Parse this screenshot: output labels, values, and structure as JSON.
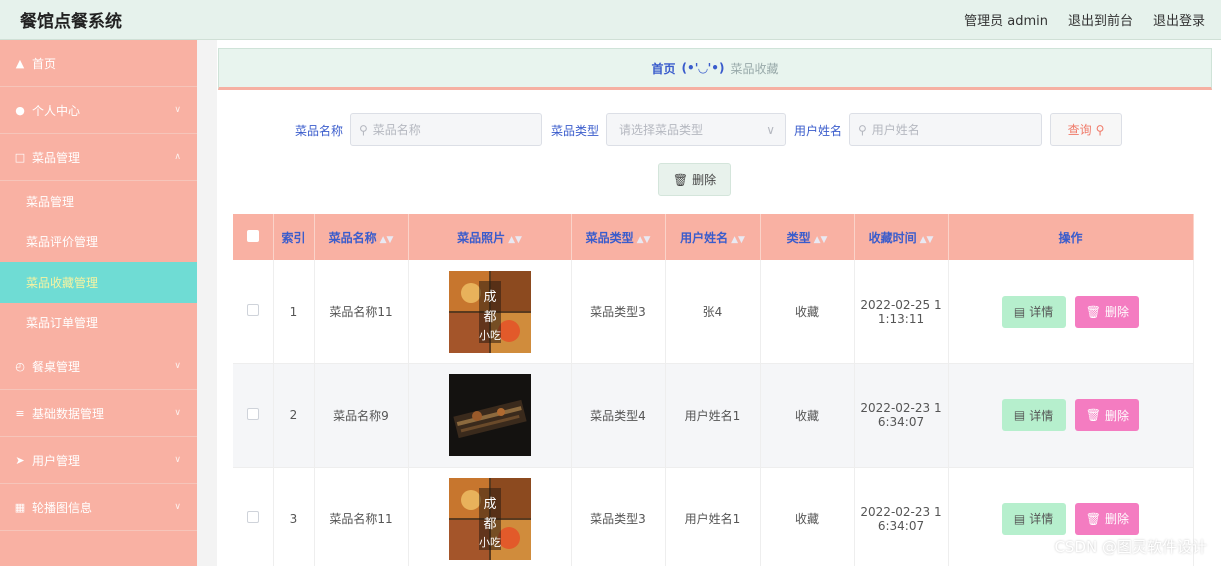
{
  "header": {
    "app_title": "餐馆点餐系统",
    "admin_label": "管理员 admin",
    "front_link": "退出到前台",
    "logout_link": "退出登录"
  },
  "sidebar": {
    "items": [
      {
        "icon": "home-icon",
        "label": "首页"
      },
      {
        "icon": "user-icon",
        "label": "个人中心"
      },
      {
        "icon": "expand-icon",
        "label": "菜品管理"
      }
    ],
    "sub_items": [
      "菜品管理",
      "菜品评价管理",
      "菜品收藏管理",
      "菜品订单管理"
    ],
    "items_after": [
      {
        "icon": "clock-icon",
        "label": "餐桌管理"
      },
      {
        "icon": "list-icon",
        "label": "基础数据管理"
      },
      {
        "icon": "plane-icon",
        "label": "用户管理"
      },
      {
        "icon": "grid-icon",
        "label": "轮播图信息"
      }
    ]
  },
  "breadcrumb": {
    "home": "首页",
    "face": "(•'◡'•)",
    "current": "菜品收藏"
  },
  "search": {
    "name_label": "菜品名称",
    "name_placeholder": "菜品名称",
    "type_label": "菜品类型",
    "type_placeholder": "请选择菜品类型",
    "user_label": "用户姓名",
    "user_placeholder": "用户姓名",
    "query_button": "查询",
    "delete_button": "删除"
  },
  "table": {
    "headers": [
      "索引",
      "菜品名称",
      "菜品照片",
      "菜品类型",
      "用户姓名",
      "类型",
      "收藏时间",
      "操作"
    ],
    "rows": [
      {
        "index": "1",
        "name": "菜品名称11",
        "type": "菜品类型3",
        "user": "张4",
        "kind": "收藏",
        "time_line1": "2022-02-25 1",
        "time_line2": "1:13:11"
      },
      {
        "index": "2",
        "name": "菜品名称9",
        "type": "菜品类型4",
        "user": "用户姓名1",
        "kind": "收藏",
        "time_line1": "2022-02-23 1",
        "time_line2": "6:34:07"
      },
      {
        "index": "3",
        "name": "菜品名称11",
        "type": "菜品类型3",
        "user": "用户姓名1",
        "kind": "收藏",
        "time_line1": "2022-02-23 1",
        "time_line2": "6:34:07"
      }
    ],
    "detail_button": "详情",
    "delete_button": "删除"
  },
  "watermark": "CSDN @图灵软件设计"
}
